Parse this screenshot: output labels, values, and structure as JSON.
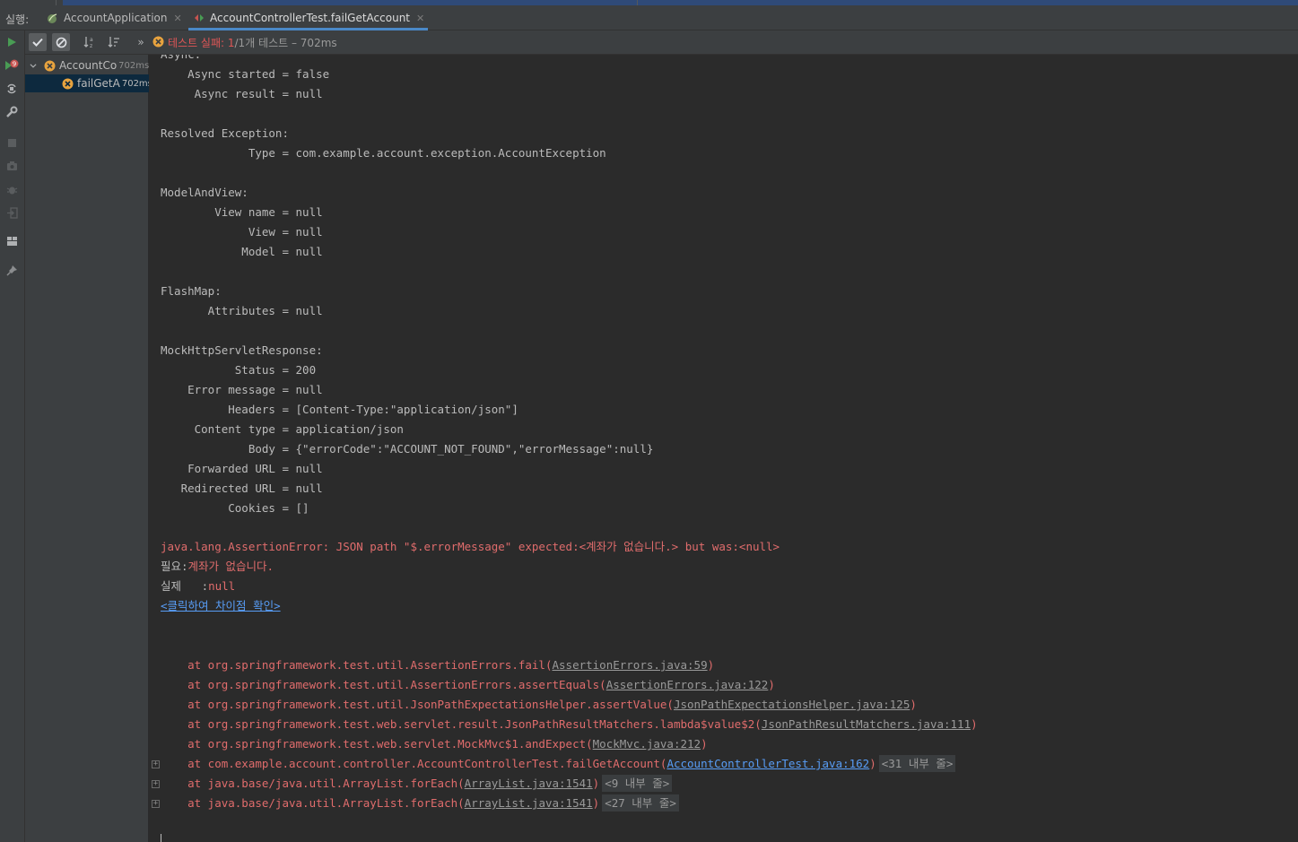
{
  "run_label": "실행:",
  "tabs": [
    {
      "label": "AccountApplication",
      "icon": "spring-app-icon",
      "active": false
    },
    {
      "label": "AccountControllerTest.failGetAccount",
      "icon": "test-run-icon",
      "active": true
    }
  ],
  "status": {
    "fail_text": "테스트 실패: 1",
    "rest_text": " /1개 테스트 – 702ms"
  },
  "tree": [
    {
      "label": "AccountCo",
      "duration": "702ms",
      "icon": "test-failed-icon"
    },
    {
      "label": "failGetA",
      "duration": "702ms",
      "icon": "test-failed-icon"
    }
  ],
  "console": {
    "top_partial": "Async:",
    "lines": [
      "    Async started = false",
      "     Async result = null",
      "",
      "Resolved Exception:",
      "             Type = com.example.account.exception.AccountException",
      "",
      "ModelAndView:",
      "        View name = null",
      "             View = null",
      "            Model = null",
      "",
      "FlashMap:",
      "       Attributes = null",
      "",
      "MockHttpServletResponse:",
      "           Status = 200",
      "    Error message = null",
      "          Headers = [Content-Type:\"application/json\"]",
      "     Content type = application/json",
      "             Body = {\"errorCode\":\"ACCOUNT_NOT_FOUND\",\"errorMessage\":null}",
      "    Forwarded URL = null",
      "   Redirected URL = null",
      "          Cookies = []"
    ],
    "assertion_error": "java.lang.AssertionError: JSON path \"$.errorMessage\" expected:<계좌가 없습니다.> but was:<null>",
    "expected_label": "필요:",
    "expected_value": "계좌가 없습니다.",
    "actual_label": "실제   :",
    "actual_value": "null",
    "diff_link": "<클릭하여 차이점 확인>",
    "stack": [
      {
        "prefix": "    at org.springframework.test.util.AssertionErrors.fail(",
        "link": "AssertionErrors.java:59",
        "suffix": ")",
        "fold": "",
        "blue": false
      },
      {
        "prefix": "    at org.springframework.test.util.AssertionErrors.assertEquals(",
        "link": "AssertionErrors.java:122",
        "suffix": ")",
        "fold": "",
        "blue": false
      },
      {
        "prefix": "    at org.springframework.test.util.JsonPathExpectationsHelper.assertValue(",
        "link": "JsonPathExpectationsHelper.java:125",
        "suffix": ")",
        "fold": "",
        "blue": false
      },
      {
        "prefix": "    at org.springframework.test.web.servlet.result.JsonPathResultMatchers.lambda$value$2(",
        "link": "JsonPathResultMatchers.java:111",
        "suffix": ")",
        "fold": "",
        "blue": false
      },
      {
        "prefix": "    at org.springframework.test.web.servlet.MockMvc$1.andExpect(",
        "link": "MockMvc.java:212",
        "suffix": ")",
        "fold": "",
        "blue": false
      },
      {
        "prefix": "    at com.example.account.controller.AccountControllerTest.failGetAccount(",
        "link": "AccountControllerTest.java:162",
        "suffix": ")",
        "fold": "<31 내부 줄>",
        "blue": true
      },
      {
        "prefix": "    at java.base/java.util.ArrayList.forEach(",
        "link": "ArrayList.java:1541",
        "suffix": ")",
        "fold": "<9 내부 줄>",
        "blue": false
      },
      {
        "prefix": "    at java.base/java.util.ArrayList.forEach(",
        "link": "ArrayList.java:1541",
        "suffix": ")",
        "fold": "<27 내부 줄>",
        "blue": false
      }
    ]
  },
  "colors": {
    "error": "#e06c6c",
    "link_blue": "#589df6",
    "accent": "#4a88c7",
    "background": "#2b2b2b"
  }
}
